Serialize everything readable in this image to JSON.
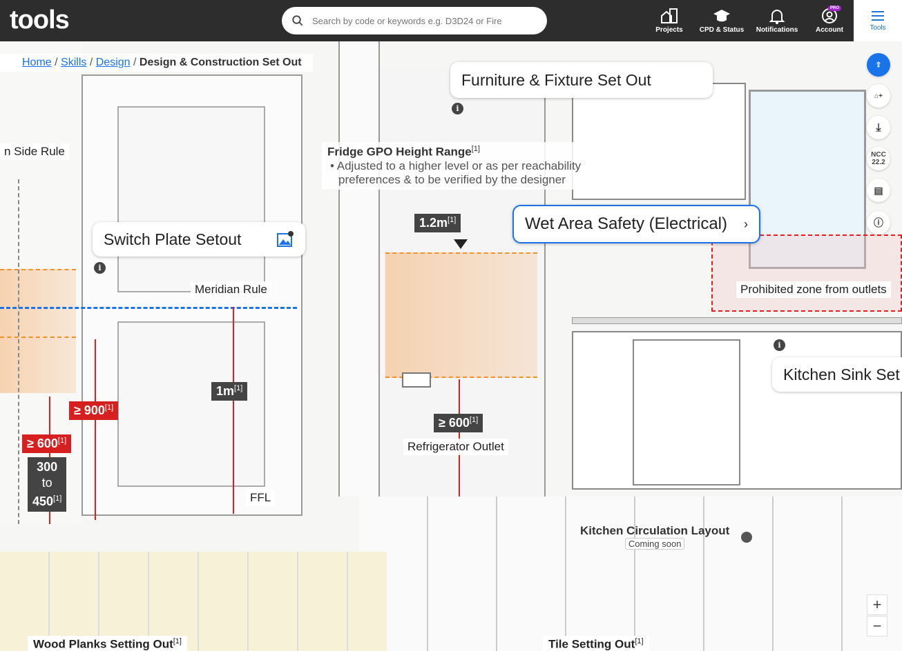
{
  "header": {
    "logo": "tools",
    "search_placeholder": "Search by code or keywords e.g. D3D24 or Fire",
    "nav": [
      {
        "label": "Projects"
      },
      {
        "label": "CPD & Status"
      },
      {
        "label": "Notifications"
      },
      {
        "label": "Account",
        "badge": "PRO"
      },
      {
        "label": "Tools"
      }
    ]
  },
  "breadcrumb": {
    "items": [
      "Home",
      "Skills",
      "Design"
    ],
    "current": "Design & Construction Set Out",
    "sep": "/"
  },
  "cards": {
    "switch_plate": "Switch Plate Setout",
    "furniture": "Furniture & Fixture Set Out",
    "wet_area": "Wet Area Safety (Electrical)",
    "kitchen_sink": "Kitchen Sink Set"
  },
  "labels": {
    "side_rule": "n Side Rule",
    "meridian": "Meridian Rule",
    "ffl": "FFL",
    "fridge_title": "Fridge GPO Height Range",
    "fridge_ref": "[1]",
    "fridge_bullet": "Adjusted to a higher level or as per reachability preferences & to be verified by the designer",
    "refrigerator_outlet": "Refrigerator Outlet",
    "prohibited": "Prohibited zone from outlets",
    "kitchen_circ": "Kitchen Circulation Layout",
    "coming_soon": "Coming soon",
    "wood": "Wood Planks Setting Out",
    "tile": "Tile Setting Out",
    "ref": "[1]"
  },
  "dims": {
    "d1_2m": "1.2m",
    "d1m": "1m",
    "ge600_fridge": "≥ 600",
    "ge900": "≥ 900",
    "ge600": "≥ 600",
    "r300": "300",
    "to": "to",
    "r450": "450"
  },
  "sidebar": {
    "ncc": "NCC",
    "ncc_ver": "22.2"
  },
  "zoom": {
    "in": "+",
    "out": "−"
  },
  "colors": {
    "accent": "#1a73e8",
    "red": "#d62020",
    "orange": "#f0902a",
    "topbar": "#2d2d2d"
  }
}
